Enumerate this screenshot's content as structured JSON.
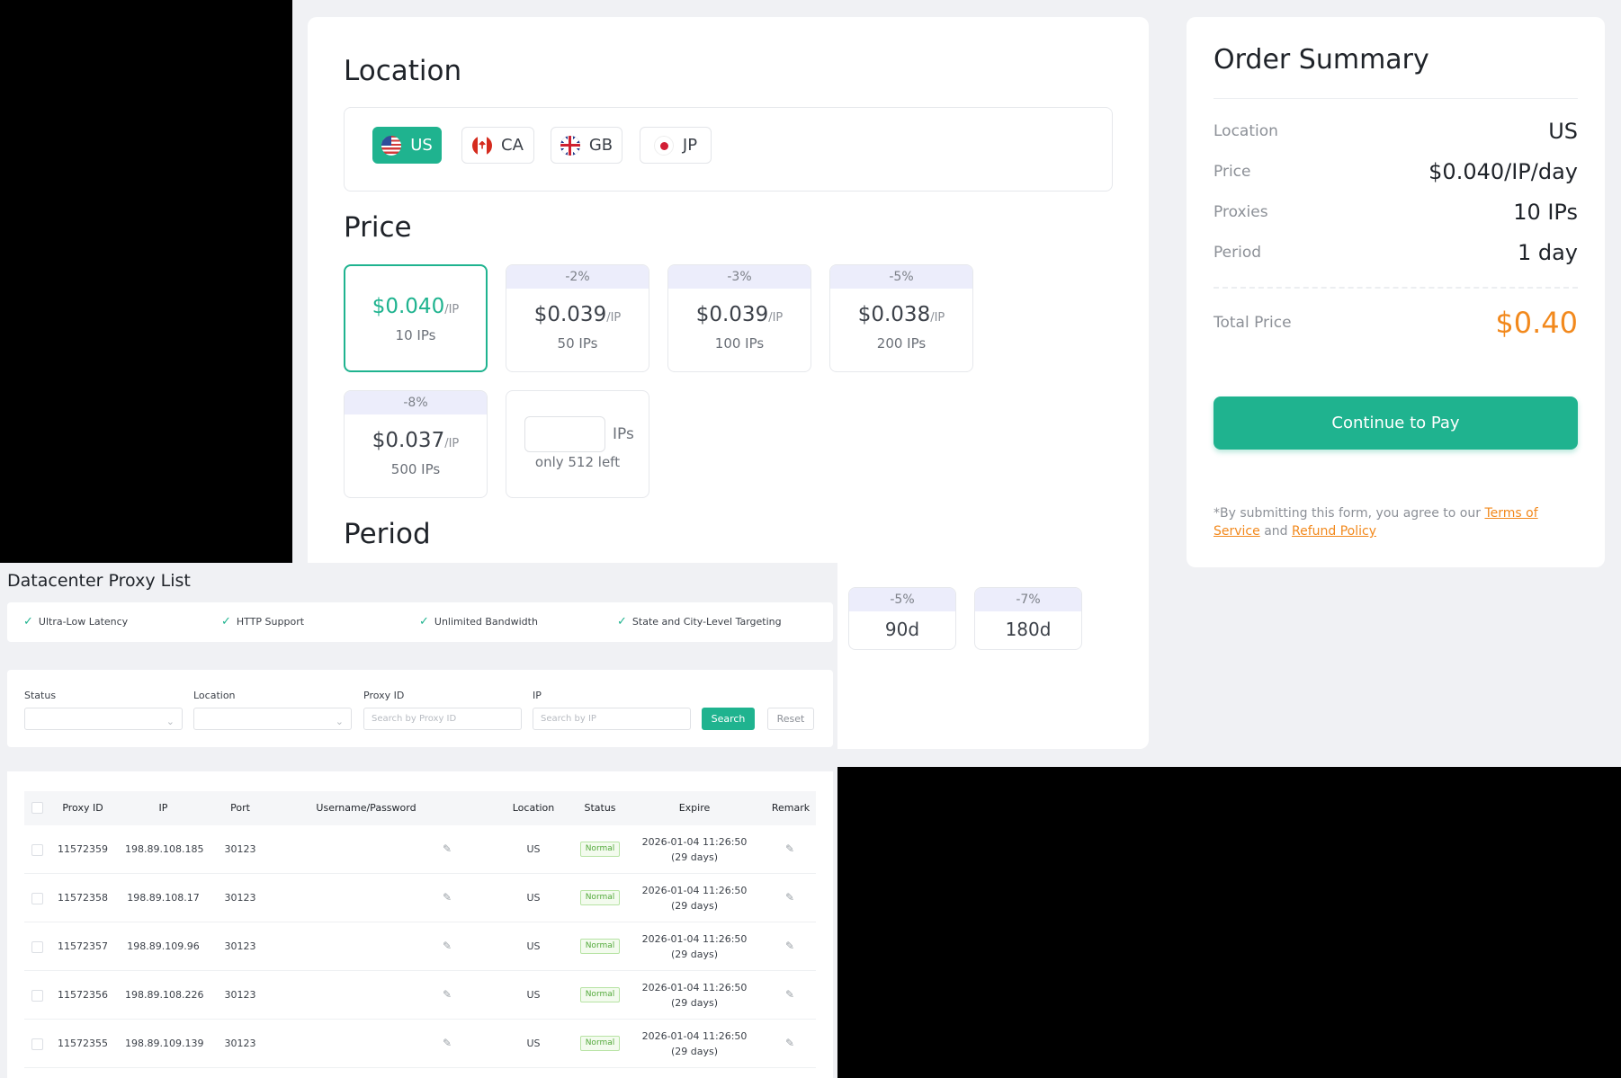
{
  "location": {
    "title": "Location",
    "options": [
      {
        "code": "US",
        "flag": "us-flag-icon",
        "active": true
      },
      {
        "code": "CA",
        "flag": "ca-flag-icon",
        "active": false
      },
      {
        "code": "GB",
        "flag": "gb-flag-icon",
        "active": false
      },
      {
        "code": "JP",
        "flag": "jp-flag-icon",
        "active": false
      }
    ]
  },
  "price": {
    "title": "Price",
    "unit": "/IP",
    "tiers": [
      {
        "discount": "",
        "price": "$0.040",
        "qty": "10 IPs",
        "active": true
      },
      {
        "discount": "-2%",
        "price": "$0.039",
        "qty": "50 IPs",
        "active": false
      },
      {
        "discount": "-3%",
        "price": "$0.039",
        "qty": "100 IPs",
        "active": false
      },
      {
        "discount": "-5%",
        "price": "$0.038",
        "qty": "200 IPs",
        "active": false
      },
      {
        "discount": "-8%",
        "price": "$0.037",
        "qty": "500 IPs",
        "active": false
      }
    ],
    "custom": {
      "value": "",
      "unit": "IPs",
      "remaining": "only 512 left"
    }
  },
  "period": {
    "title": "Period",
    "options": [
      {
        "discount": "-5%",
        "label": "90d"
      },
      {
        "discount": "-7%",
        "label": "180d"
      }
    ]
  },
  "summary": {
    "title": "Order Summary",
    "rows": [
      {
        "label": "Location",
        "value": "US"
      },
      {
        "label": "Price",
        "value": "$0.040/IP/day"
      },
      {
        "label": "Proxies",
        "value": "10 IPs"
      },
      {
        "label": "Period",
        "value": "1 day"
      }
    ],
    "total_label": "Total Price",
    "total_value": "$0.40",
    "pay_button": "Continue to Pay",
    "agree_prefix": "*By submitting this form, you agree to our",
    "terms_link": "Terms of Service",
    "agree_and": "and",
    "refund_link": "Refund Policy"
  },
  "proxy_list": {
    "title": "Datacenter Proxy List",
    "features": [
      "Ultra-Low Latency",
      "HTTP Support",
      "Unlimited Bandwidth",
      "State and City-Level Targeting"
    ],
    "filters": {
      "status_label": "Status",
      "location_label": "Location",
      "proxy_id_label": "Proxy ID",
      "proxy_id_placeholder": "Search by Proxy ID",
      "ip_label": "IP",
      "ip_placeholder": "Search by IP",
      "search_button": "Search",
      "reset_button": "Reset"
    },
    "columns": [
      "Proxy ID",
      "IP",
      "Port",
      "Username/Password",
      "Location",
      "Status",
      "Expire",
      "Remark"
    ],
    "rows": [
      {
        "id": "11572359",
        "ip": "198.89.108.185",
        "port": "30123",
        "location": "US",
        "status": "Normal",
        "expire": "2026-01-04 11:26:50",
        "expire_days": "(29 days)"
      },
      {
        "id": "11572358",
        "ip": "198.89.108.17",
        "port": "30123",
        "location": "US",
        "status": "Normal",
        "expire": "2026-01-04 11:26:50",
        "expire_days": "(29 days)"
      },
      {
        "id": "11572357",
        "ip": "198.89.109.96",
        "port": "30123",
        "location": "US",
        "status": "Normal",
        "expire": "2026-01-04 11:26:50",
        "expire_days": "(29 days)"
      },
      {
        "id": "11572356",
        "ip": "198.89.108.226",
        "port": "30123",
        "location": "US",
        "status": "Normal",
        "expire": "2026-01-04 11:26:50",
        "expire_days": "(29 days)"
      },
      {
        "id": "11572355",
        "ip": "198.89.109.139",
        "port": "30123",
        "location": "US",
        "status": "Normal",
        "expire": "2026-01-04 11:26:50",
        "expire_days": "(29 days)"
      }
    ]
  },
  "colors": {
    "accent": "#1fb38f",
    "total": "#f2891d",
    "discount_bg": "#ecedfb"
  }
}
